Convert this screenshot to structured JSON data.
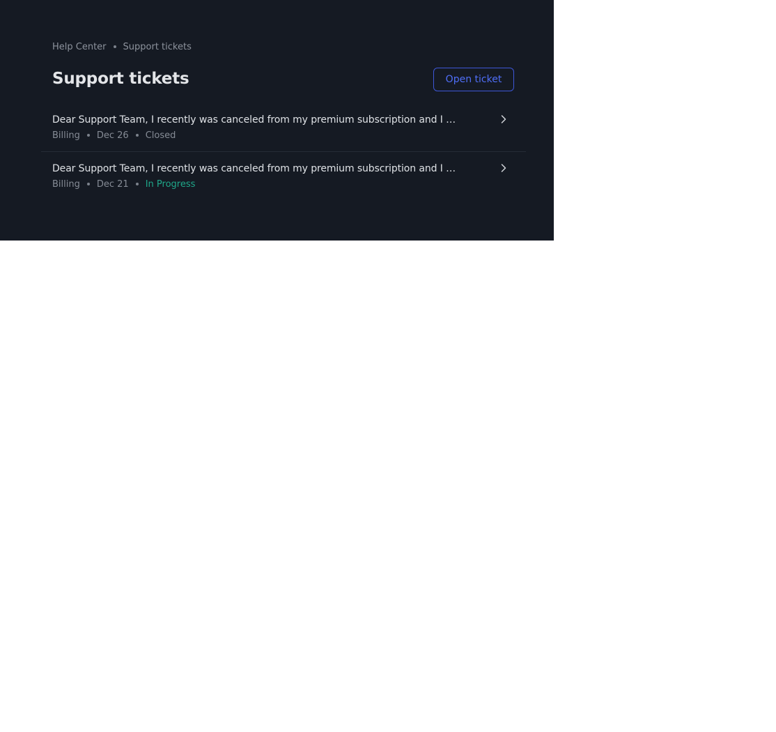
{
  "breadcrumb": {
    "items": [
      "Help Center",
      "Support tickets"
    ]
  },
  "header": {
    "title": "Support tickets",
    "open_ticket_label": "Open ticket"
  },
  "tickets": [
    {
      "title": "Dear Support Team, I recently was canceled from my premium subscription and I would like to know why",
      "category": "Billing",
      "date": "Dec 26",
      "status": "Closed"
    },
    {
      "title": "Dear Support Team, I recently was canceled from my premium subscription and I would like to know why",
      "category": "Billing",
      "date": "Dec 21",
      "status": "In Progress"
    }
  ],
  "icons": {
    "row_action": "chevron-right-icon"
  },
  "colors": {
    "panel_background": "#151a23",
    "accent": "#4f6ef7",
    "status_in_progress": "#1fa88a",
    "muted_text": "#868c96"
  }
}
